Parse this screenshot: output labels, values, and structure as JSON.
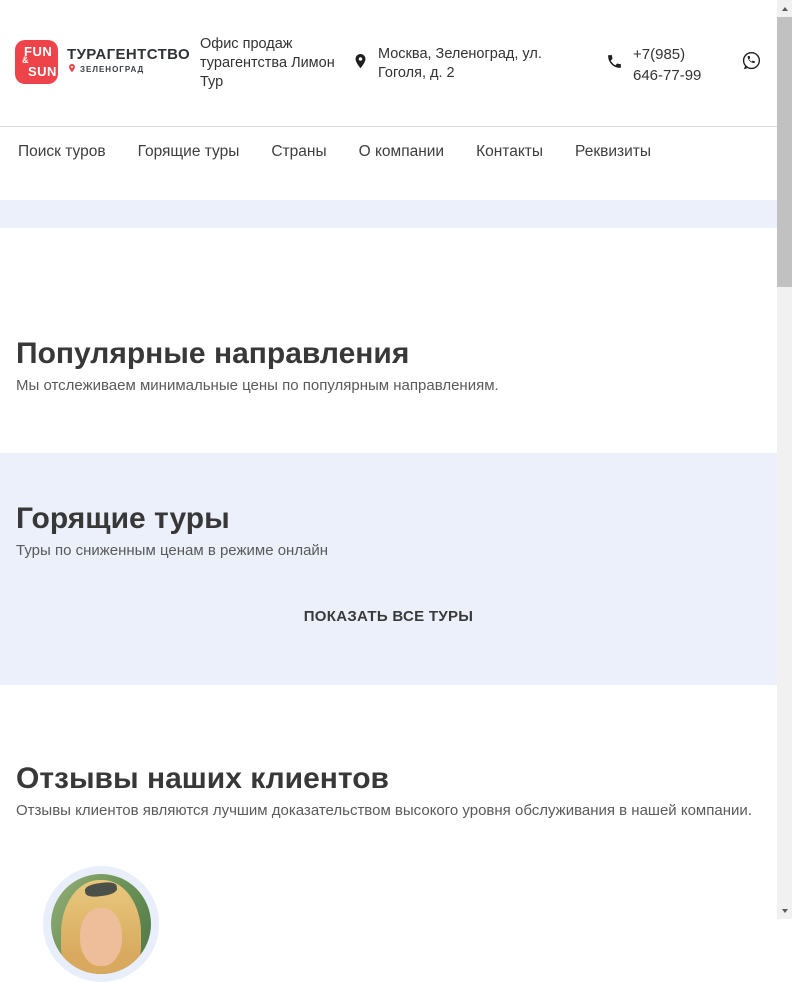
{
  "header": {
    "logo": {
      "line1": "FUN",
      "amp": "&",
      "line2": "SUN",
      "brand": "ТУРАГЕНТСТВО",
      "city": "ЗЕЛЕНОГРАД"
    },
    "office": "Офис продаж турагентства Лимон Тур",
    "address": "Москва, Зеленоград, ул. Гоголя, д. 2",
    "phone": "+7(985) 646-77-99"
  },
  "nav": {
    "items": [
      "Поиск туров",
      "Горящие туры",
      "Страны",
      "О компании",
      "Контакты",
      "Реквизиты"
    ]
  },
  "sections": {
    "popular": {
      "title": "Популярные направления",
      "subtitle": "Мы отслеживаем минимальные цены по популярным направлениям."
    },
    "hot": {
      "title": "Горящие туры",
      "subtitle": "Туры по сниженным ценам в режиме онлайн",
      "button": "ПОКАЗАТЬ ВСЕ ТУРЫ"
    },
    "reviews": {
      "title": "Отзывы наших клиентов",
      "subtitle": "Отзывы клиентов являются лучшим доказательством высокого уровня обслуживания в нашей компании."
    }
  },
  "icons": {
    "location_pin": "map-pin",
    "phone": "phone-handset",
    "whatsapp": "whatsapp-bubble"
  },
  "colors": {
    "brand_red": "#ee4348",
    "lavender": "#ebf0fb",
    "heading": "#383838",
    "subtitle": "#5a5a5a",
    "header_text": "#333333",
    "nav_text": "#3e3e3e",
    "border_gray": "#dcdcdc",
    "sb_track": "#f1f1f1",
    "sb_thumb": "#c1c1c1"
  }
}
